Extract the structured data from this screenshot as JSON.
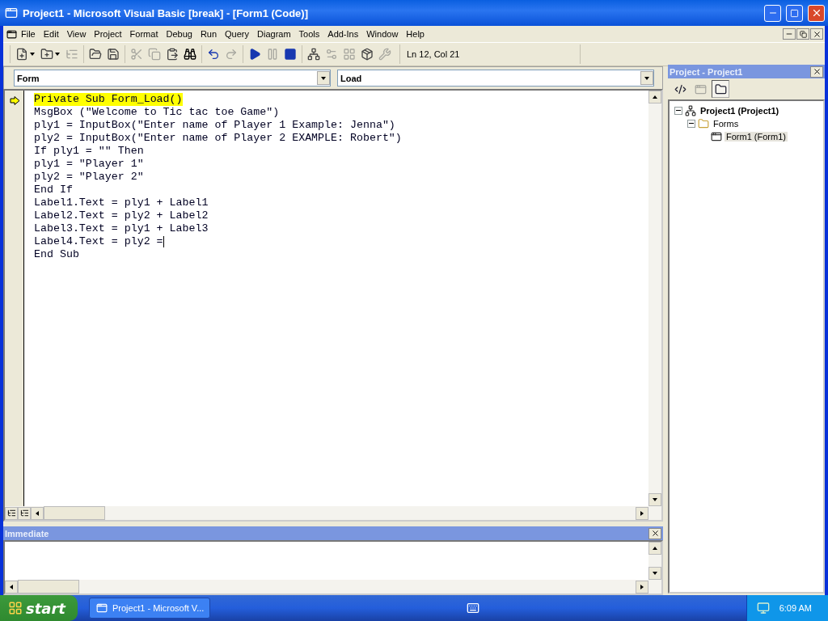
{
  "window": {
    "title": "Project1 - Microsoft Visual Basic [break] - [Form1 (Code)]"
  },
  "menu": [
    "File",
    "Edit",
    "View",
    "Project",
    "Format",
    "Debug",
    "Run",
    "Query",
    "Diagram",
    "Tools",
    "Add-Ins",
    "Window",
    "Help"
  ],
  "toolbar": {
    "groups": [
      [
        {
          "kind": "add-project",
          "dropdown": true,
          "disabled": false
        },
        {
          "kind": "add-form",
          "dropdown": true,
          "disabled": false
        },
        {
          "kind": "menu-editor",
          "dropdown": false,
          "disabled": true
        }
      ],
      [
        {
          "kind": "open",
          "dropdown": false,
          "disabled": false
        },
        {
          "kind": "save",
          "dropdown": false,
          "disabled": false
        }
      ],
      [
        {
          "kind": "cut",
          "dropdown": false,
          "disabled": true
        },
        {
          "kind": "copy",
          "dropdown": false,
          "disabled": true
        },
        {
          "kind": "paste",
          "dropdown": false,
          "disabled": false
        },
        {
          "kind": "find",
          "dropdown": false,
          "disabled": false
        }
      ],
      [
        {
          "kind": "undo",
          "dropdown": false,
          "disabled": false
        },
        {
          "kind": "redo",
          "dropdown": false,
          "disabled": true
        }
      ],
      [
        {
          "kind": "run",
          "dropdown": false,
          "disabled": false
        },
        {
          "kind": "pause",
          "dropdown": false,
          "disabled": true
        },
        {
          "kind": "stop",
          "dropdown": false,
          "disabled": false
        }
      ],
      [
        {
          "kind": "project-explorer",
          "dropdown": false,
          "disabled": false
        },
        {
          "kind": "properties",
          "dropdown": false,
          "disabled": true
        },
        {
          "kind": "form-layout",
          "dropdown": false,
          "disabled": true
        },
        {
          "kind": "object-browser",
          "dropdown": false,
          "disabled": false
        },
        {
          "kind": "toolbox",
          "dropdown": false,
          "disabled": true
        }
      ]
    ],
    "position": "Ln 12, Col 21"
  },
  "code_window": {
    "object": "Form",
    "procedure": "Load",
    "lines": [
      {
        "text": "Private Sub Form_Load()",
        "current": true,
        "caret": false
      },
      {
        "text": "MsgBox (\"Welcome to Tic tac toe Game\")",
        "current": false,
        "caret": false
      },
      {
        "text": "ply1 = InputBox(\"Enter name of Player 1 Example: Jenna\")",
        "current": false,
        "caret": false
      },
      {
        "text": "ply2 = InputBox(\"Enter name of Player 2 EXAMPLE: Robert\")",
        "current": false,
        "caret": false
      },
      {
        "text": "If ply1 = \"\" Then",
        "current": false,
        "caret": false
      },
      {
        "text": "ply1 = \"Player 1\"",
        "current": false,
        "caret": false
      },
      {
        "text": "ply2 = \"Player 2\"",
        "current": false,
        "caret": false
      },
      {
        "text": "End If",
        "current": false,
        "caret": false
      },
      {
        "text": "Label1.Text = ply1 + Label1",
        "current": false,
        "caret": false
      },
      {
        "text": "Label2.Text = ply2 + Label2",
        "current": false,
        "caret": false
      },
      {
        "text": "Label3.Text = ply1 + Label3",
        "current": false,
        "caret": false
      },
      {
        "text": "Label4.Text = ply2 =",
        "current": false,
        "caret": true
      },
      {
        "text": "End Sub",
        "current": false,
        "caret": false
      }
    ]
  },
  "immediate": {
    "title": "Immediate"
  },
  "project_panel": {
    "title": "Project - Project1",
    "buttons": [
      {
        "kind": "view-code",
        "disabled": false,
        "pressed": false
      },
      {
        "kind": "view-object",
        "disabled": true,
        "pressed": false
      },
      {
        "kind": "toggle-folders",
        "disabled": false,
        "pressed": true
      }
    ],
    "tree": [
      {
        "label": "Project1 (Project1)",
        "kind": "project",
        "expanded": true,
        "selected": false,
        "children": [
          {
            "label": "Forms",
            "kind": "folder",
            "expanded": true,
            "selected": false,
            "children": [
              {
                "label": "Form1 (Form1)",
                "kind": "form",
                "selected": true
              }
            ]
          }
        ]
      }
    ]
  },
  "taskbar": {
    "start": "start",
    "tasks": [
      {
        "label": "Project1 - Microsoft V...",
        "selected": false
      }
    ],
    "clock": "6:09 AM"
  }
}
